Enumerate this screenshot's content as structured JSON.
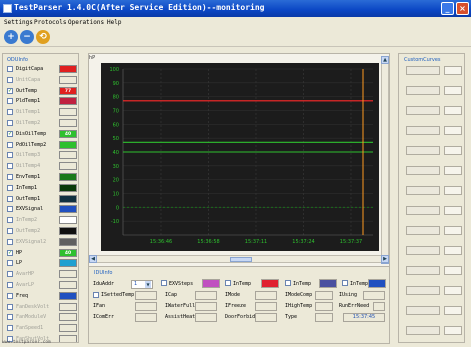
{
  "window": {
    "title": "TestParser 1.4.0C(After Service Edition)--monitoring",
    "minimize": "_",
    "close": "×"
  },
  "menu": [
    "Settings",
    "Protocols",
    "Operations",
    "Help"
  ],
  "toolbar": {
    "zoom_in": "+",
    "zoom_out": "−",
    "reset": "⟲"
  },
  "signals": {
    "legend": "ODUInfo",
    "items": [
      {
        "label": "DigitCapa",
        "checked": false,
        "enabled": true,
        "color": "#e02020",
        "value": ""
      },
      {
        "label": "UnitCapa",
        "checked": false,
        "enabled": false,
        "color": "",
        "value": ""
      },
      {
        "label": "OutTemp",
        "checked": true,
        "enabled": true,
        "color": "#e02020",
        "value": "77"
      },
      {
        "label": "PldTemp1",
        "checked": false,
        "enabled": true,
        "color": "#c02040",
        "value": ""
      },
      {
        "label": "OilTemp1",
        "checked": false,
        "enabled": false,
        "color": "",
        "value": ""
      },
      {
        "label": "OilTemp2",
        "checked": false,
        "enabled": false,
        "color": "",
        "value": ""
      },
      {
        "label": "DisOilTemp",
        "checked": true,
        "enabled": true,
        "color": "#2ec02e",
        "value": "40"
      },
      {
        "label": "PdOilTemp2",
        "checked": false,
        "enabled": true,
        "color": "#2ec02e",
        "value": ""
      },
      {
        "label": "OilTemp3",
        "checked": false,
        "enabled": false,
        "color": "",
        "value": ""
      },
      {
        "label": "OilTemp4",
        "checked": false,
        "enabled": false,
        "color": "",
        "value": ""
      },
      {
        "label": "EnvTemp1",
        "checked": false,
        "enabled": true,
        "color": "#1a7a1a",
        "value": ""
      },
      {
        "label": "InTemp1",
        "checked": false,
        "enabled": true,
        "color": "#0a3a0a",
        "value": ""
      },
      {
        "label": "OutTemp1",
        "checked": false,
        "enabled": true,
        "color": "#103040",
        "value": ""
      },
      {
        "label": "EXVSignal",
        "checked": false,
        "enabled": true,
        "color": "#2050c0",
        "value": ""
      },
      {
        "label": "InTemp2",
        "checked": false,
        "enabled": false,
        "color": "#ffffff",
        "value": ""
      },
      {
        "label": "OutTemp2",
        "checked": false,
        "enabled": false,
        "color": "#101010",
        "value": ""
      },
      {
        "label": "EXVSignal2",
        "checked": false,
        "enabled": false,
        "color": "#606060",
        "value": ""
      },
      {
        "label": "HP",
        "checked": true,
        "enabled": true,
        "color": "#2ec02e",
        "value": "40"
      },
      {
        "label": "LP",
        "checked": false,
        "enabled": true,
        "color": "#20a0d0",
        "value": ""
      },
      {
        "label": "AvarHP",
        "checked": false,
        "enabled": false,
        "color": "",
        "value": ""
      },
      {
        "label": "AvarLP",
        "checked": false,
        "enabled": false,
        "color": "",
        "value": ""
      },
      {
        "label": "Freq",
        "checked": false,
        "enabled": true,
        "color": "#2050c0",
        "value": ""
      },
      {
        "label": "FanDeskVolt",
        "checked": false,
        "enabled": false,
        "color": "",
        "value": ""
      },
      {
        "label": "FanModuleV",
        "checked": false,
        "enabled": false,
        "color": "",
        "value": ""
      },
      {
        "label": "FanSpeed1",
        "checked": false,
        "enabled": false,
        "color": "",
        "value": ""
      },
      {
        "label": "FanShutVolt",
        "checked": false,
        "enabled": false,
        "color": "",
        "value": ""
      }
    ]
  },
  "chart_data": {
    "type": "line",
    "corner_label": "hP",
    "ylim": [
      -20,
      100
    ],
    "yticks": [
      100,
      90,
      80,
      70,
      60,
      50,
      40,
      30,
      20,
      10,
      0,
      -10
    ],
    "xticks": [
      "15:36:46",
      "15:36:58",
      "15:37:11",
      "15:37:24",
      "15:37:37"
    ],
    "grid": true,
    "background": "#1c1c1c",
    "series": [
      {
        "values": [
          77,
          77
        ],
        "color": "#ff2a2a"
      },
      {
        "values": [
          47,
          47
        ],
        "color": "#2ec02e"
      },
      {
        "values": [
          40,
          40
        ],
        "color": "#2ec02e"
      }
    ],
    "markers": [
      {
        "kind": "vertical-line",
        "color": "#ff9a20"
      }
    ]
  },
  "info": {
    "legend": "IDUInfo",
    "row1": {
      "idu_addr_label": "IduAddr",
      "idu_addr_value": "1",
      "c1": "EXVSteps",
      "c2": "InTemp",
      "c3": "InTemp",
      "c4": "InTemp"
    },
    "row1_colors": [
      "#c050c0",
      "#e02030",
      "#4a50a0",
      "#2050c0"
    ],
    "row2": [
      "ISettedTemp",
      "ICap",
      "IMode",
      "IModeComp",
      "IUsing"
    ],
    "row3": [
      "IFan",
      "IWaterFull",
      "IFreeze",
      "IHighTemp",
      "RunErrNeed"
    ],
    "row4": [
      "IComErr",
      "AssistHeat",
      "DoorForbid",
      "Type"
    ],
    "time": "15:37:45"
  },
  "right": {
    "legend": "CustomCurves",
    "rows": 14
  },
  "status": "www.testparser.com"
}
